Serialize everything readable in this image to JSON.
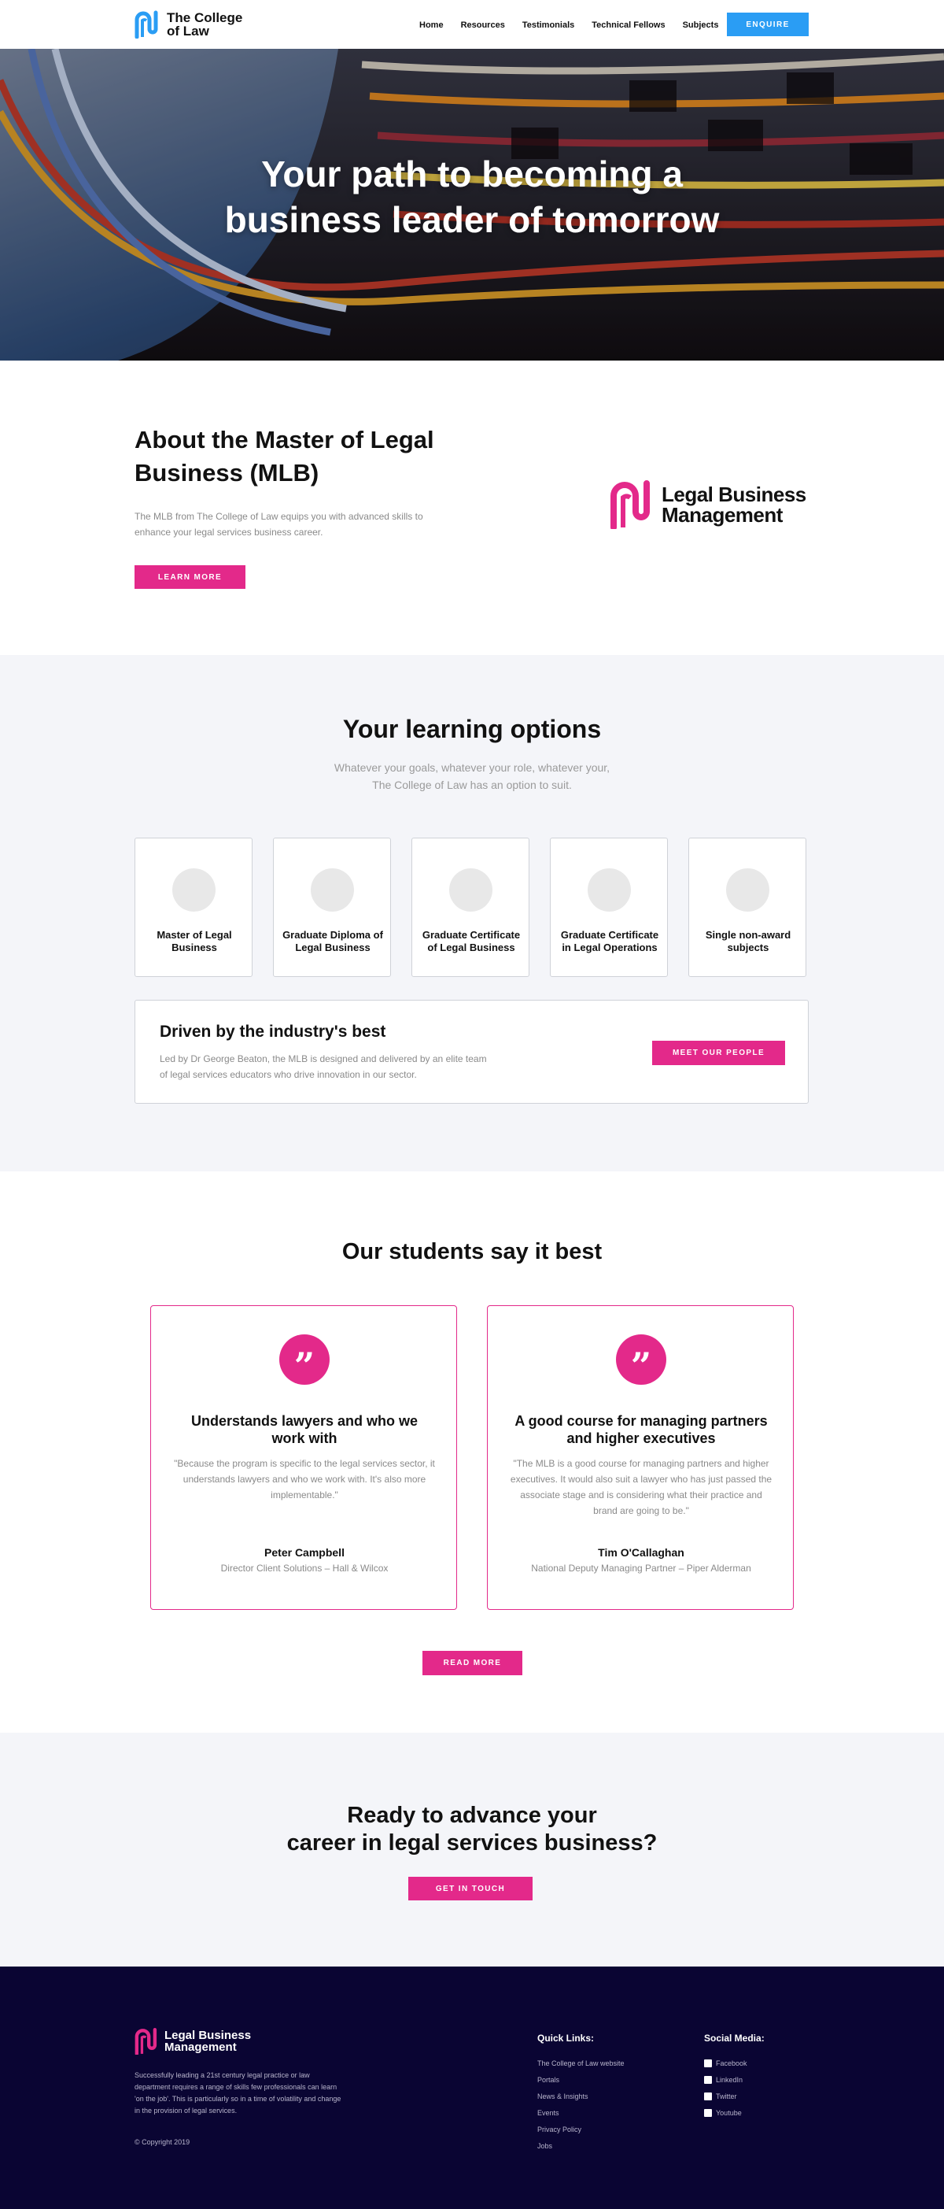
{
  "header": {
    "logo_text_line1": "The College",
    "logo_text_line2": "of Law",
    "nav": [
      "Home",
      "Resources",
      "Testimonials",
      "Technical Fellows",
      "Subjects"
    ],
    "enquire_label": "ENQUIRE"
  },
  "hero": {
    "title_line1": "Your path to becoming a",
    "title_line2": "business leader of tomorrow"
  },
  "about": {
    "title": "About the Master of Legal Business (MLB)",
    "text": "The MLB from The College of Law  equips you with advanced skills to enhance your legal services business career.",
    "button_label": "LEARN MORE",
    "logo_line1": "Legal Business",
    "logo_line2": "Management"
  },
  "learning": {
    "title": "Your learning options",
    "subtitle_line1": "Whatever your goals, whatever your role, whatever your,",
    "subtitle_line2": "The College of Law has an option to suit.",
    "cards": [
      "Master of Legal Business",
      "Graduate Diploma of Legal Business",
      "Graduate Certificate of Legal Business",
      "Graduate Certificate in Legal Operations",
      "Single non-award subjects"
    ],
    "industry_title": "Driven by the industry's best",
    "industry_text": "Led by Dr George Beaton, the MLB is designed and delivered by  an elite team of legal services educators who drive innovation in our sector.",
    "industry_button": "MEET OUR PEOPLE"
  },
  "students": {
    "title": "Our students say it best",
    "testimonials": [
      {
        "heading": "Understands lawyers and who we work with",
        "quote": "\"Because the program is specific to the legal services sector, it understands lawyers and who we work with. It's also more implementable.\"",
        "name": "Peter Campbell",
        "role": "Director Client Solutions – Hall & Wilcox"
      },
      {
        "heading": "A good course for managing partners and higher executives",
        "quote": "\"The MLB is a good course for managing partners and higher executives. It would also suit a lawyer who has just passed the associate stage and is considering what their practice and brand are going to be.\"",
        "name": "Tim O'Callaghan",
        "role": "National Deputy Managing Partner – Piper Alderman"
      }
    ],
    "quote_glyph": "”",
    "read_more": "READ MORE"
  },
  "cta": {
    "title_line1": "Ready to advance your",
    "title_line2": "career in legal services business?",
    "button": "GET IN TOUCH"
  },
  "footer": {
    "logo_line1": "Legal Business",
    "logo_line2": "Management",
    "description": "Successfully leading a 21st century legal practice or law department requires a range of skills few professionals can learn 'on the job'. This is particularly so in a time of volatility and change in the provision of legal services.",
    "copyright": "© Copyright 2019",
    "quick_links_title": "Quick Links:",
    "quick_links": [
      "The College of Law website",
      "Portals",
      "News & Insights",
      "Events",
      "Privacy Policy",
      "Jobs"
    ],
    "social_title": "Social Media:",
    "social": [
      {
        "label": "Facebook",
        "icon": "facebook-icon"
      },
      {
        "label": "LinkedIn",
        "icon": "linkedin-icon"
      },
      {
        "label": "Twitter",
        "icon": "twitter-icon"
      },
      {
        "label": "Youtube",
        "icon": "youtube-icon"
      }
    ]
  },
  "colors": {
    "brand_pink": "#e3298a",
    "brand_blue": "#2a9df4",
    "footer_bg": "#0a0533",
    "section_bg": "#f4f5f9"
  }
}
